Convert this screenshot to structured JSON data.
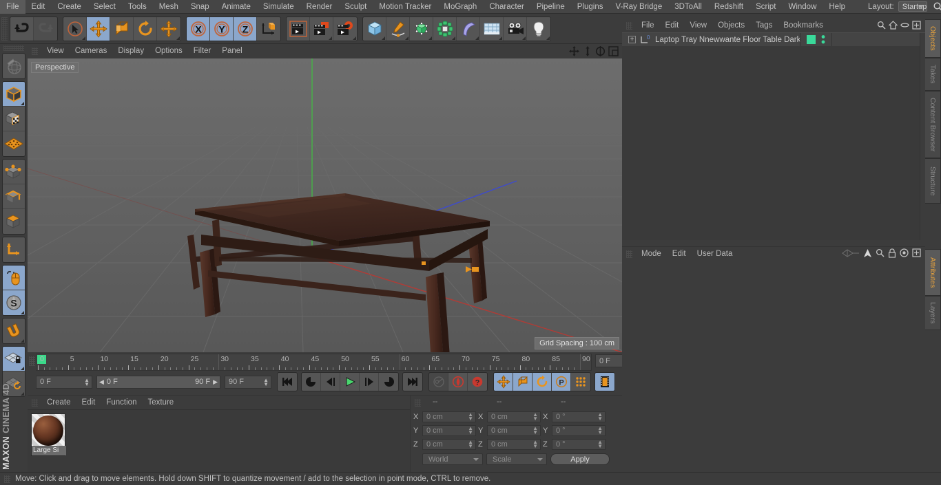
{
  "app": {
    "brand_top": "MAXON",
    "brand_bottom": "CINEMA 4D"
  },
  "menubar": {
    "items": [
      {
        "label": "File"
      },
      {
        "label": "Edit"
      },
      {
        "label": "Create"
      },
      {
        "label": "Select"
      },
      {
        "label": "Tools"
      },
      {
        "label": "Mesh"
      },
      {
        "label": "Snap"
      },
      {
        "label": "Animate"
      },
      {
        "label": "Simulate"
      },
      {
        "label": "Render"
      },
      {
        "label": "Sculpt"
      },
      {
        "label": "Motion Tracker"
      },
      {
        "label": "MoGraph"
      },
      {
        "label": "Character"
      },
      {
        "label": "Pipeline"
      },
      {
        "label": "Plugins"
      },
      {
        "label": "V-Ray Bridge"
      },
      {
        "label": "3DToAll"
      },
      {
        "label": "Redshift"
      },
      {
        "label": "Script"
      },
      {
        "label": "Window"
      },
      {
        "label": "Help"
      }
    ],
    "layout_label": "Layout:",
    "layout_value": "Startup",
    "search_icon": "search-icon"
  },
  "toolbar": {
    "groups": [
      {
        "name": "history",
        "buttons": [
          {
            "name": "undo-button",
            "icon": "undo-arrow-icon",
            "state": "normal"
          },
          {
            "name": "redo-button",
            "icon": "redo-arrow-icon",
            "state": "disabled"
          }
        ]
      },
      {
        "name": "transform-tools",
        "buttons": [
          {
            "name": "live-selection-tool",
            "icon": "cursor-circle-icon",
            "state": "normal"
          },
          {
            "name": "move-tool",
            "icon": "move-arrows-icon",
            "state": "active"
          },
          {
            "name": "scale-tool",
            "icon": "scale-box-icon",
            "state": "normal"
          },
          {
            "name": "rotate-tool",
            "icon": "rotate-circle-icon",
            "state": "normal"
          },
          {
            "name": "dynamic-place-tool",
            "icon": "move-arrows-icon",
            "state": "normal"
          }
        ]
      },
      {
        "name": "axis-locks",
        "buttons": [
          {
            "name": "lock-x-axis",
            "icon": "x-axis-icon",
            "label": "X",
            "state": "active"
          },
          {
            "name": "lock-y-axis",
            "icon": "y-axis-icon",
            "label": "Y",
            "state": "active"
          },
          {
            "name": "lock-z-axis",
            "icon": "z-axis-icon",
            "label": "Z",
            "state": "active"
          },
          {
            "name": "world-object-coord-toggle",
            "icon": "coord-system-icon",
            "state": "normal"
          }
        ]
      },
      {
        "name": "render-tools",
        "buttons": [
          {
            "name": "render-view-button",
            "icon": "render-view-icon",
            "state": "normal"
          },
          {
            "name": "render-region-button",
            "icon": "render-region-icon",
            "state": "normal"
          },
          {
            "name": "render-settings-button",
            "icon": "render-settings-icon",
            "state": "normal"
          }
        ]
      },
      {
        "name": "create-objects",
        "buttons": [
          {
            "name": "add-cube-button",
            "icon": "cube-icon",
            "state": "normal"
          },
          {
            "name": "add-spline-button",
            "icon": "pen-spline-icon",
            "state": "normal"
          },
          {
            "name": "add-nurbs-button",
            "icon": "green-cube-icon",
            "state": "normal"
          },
          {
            "name": "add-array-button",
            "icon": "array-icon",
            "state": "normal"
          },
          {
            "name": "add-deformer-button",
            "icon": "bend-deformer-icon",
            "state": "normal"
          },
          {
            "name": "add-environment-button",
            "icon": "floor-grid-icon",
            "state": "normal"
          },
          {
            "name": "add-camera-button",
            "icon": "camera-icon",
            "state": "normal"
          },
          {
            "name": "add-light-button",
            "icon": "light-bulb-icon",
            "state": "normal"
          }
        ]
      }
    ]
  },
  "leftbar": {
    "groups": [
      {
        "buttons": [
          {
            "name": "make-editable-button",
            "icon": "globe-wire-icon",
            "state": "disabled"
          }
        ]
      },
      {
        "buttons": [
          {
            "name": "model-mode-button",
            "icon": "model-cube-icon",
            "state": "active"
          },
          {
            "name": "texture-mode-button",
            "icon": "texture-cube-icon",
            "state": "normal"
          },
          {
            "name": "workplane-mode-button",
            "icon": "workplane-grid-icon",
            "state": "normal"
          }
        ]
      },
      {
        "buttons": [
          {
            "name": "points-mode-button",
            "icon": "points-cube-icon",
            "state": "normal"
          },
          {
            "name": "edges-mode-button",
            "icon": "edges-cube-icon",
            "state": "normal"
          },
          {
            "name": "polygons-mode-button",
            "icon": "polygons-cube-icon",
            "state": "normal"
          }
        ]
      },
      {
        "buttons": [
          {
            "name": "axis-mode-button",
            "icon": "axis-l-icon",
            "state": "normal"
          }
        ]
      },
      {
        "buttons": [
          {
            "name": "enable-axis-modification-button",
            "icon": "mouse-icon",
            "state": "active"
          },
          {
            "name": "world-coordinates-button",
            "icon": "compass-s-icon",
            "state": "active"
          }
        ]
      },
      {
        "buttons": [
          {
            "name": "snap-magnet-button",
            "icon": "magnet-icon",
            "state": "normal"
          }
        ]
      },
      {
        "buttons": [
          {
            "name": "lock-workplane-button",
            "icon": "workplane-lock-icon",
            "state": "active"
          },
          {
            "name": "planar-workplane-button",
            "icon": "workplane-rotate-icon",
            "state": "normal"
          }
        ]
      }
    ]
  },
  "viewport": {
    "menu": [
      {
        "label": "View"
      },
      {
        "label": "Cameras"
      },
      {
        "label": "Display"
      },
      {
        "label": "Options"
      },
      {
        "label": "Filter"
      },
      {
        "label": "Panel"
      }
    ],
    "view_label": "Perspective",
    "grid_spacing": "Grid Spacing : 100 cm",
    "axes": [
      {
        "label": "Y",
        "color": "#33cc33"
      },
      {
        "label": "Z",
        "color": "#3a4ee0"
      },
      {
        "label": "X",
        "color": "#d33a3a"
      }
    ],
    "view_icons": [
      {
        "name": "pan-view-icon"
      },
      {
        "name": "dolly-view-icon"
      },
      {
        "name": "rotate-view-icon"
      },
      {
        "name": "maximize-view-icon"
      }
    ],
    "colors": {
      "background_top": "#6e6e6e",
      "background_bottom": "#5a5a5a",
      "grid_line": "#6a6a6a",
      "x_axis": "#c0392b",
      "y_axis": "#3ba53b",
      "z_axis": "#3a4ee0",
      "table_wood_top": "#3a241d",
      "table_wood_leg": "#4e3026"
    }
  },
  "timeline": {
    "ticks": [
      "0",
      "5",
      "10",
      "15",
      "20",
      "25",
      "30",
      "35",
      "40",
      "45",
      "50",
      "55",
      "60",
      "65",
      "70",
      "75",
      "80",
      "85",
      "90"
    ],
    "current_frame_field": "0 F",
    "start_frame": "0 F",
    "slider_min": "0 F",
    "slider_max": "90 F",
    "end_frame": "90 F",
    "playhead_frame": 0,
    "range_start": 0,
    "range_end": 90
  },
  "playback": {
    "buttons": [
      {
        "name": "go-to-start-button",
        "icon": "skip-start-icon",
        "state": "normal"
      },
      {
        "name": "go-to-previous-keyframe-button",
        "icon": "prev-key-icon",
        "state": "normal"
      },
      {
        "name": "step-back-button",
        "icon": "step-back-icon",
        "state": "normal"
      },
      {
        "name": "play-button",
        "icon": "play-icon",
        "state": "normal"
      },
      {
        "name": "step-forward-button",
        "icon": "step-forward-icon",
        "state": "normal"
      },
      {
        "name": "go-to-next-keyframe-button",
        "icon": "next-key-icon",
        "state": "normal"
      },
      {
        "name": "go-to-end-button",
        "icon": "skip-end-icon",
        "state": "normal"
      },
      {
        "name": "record-active-objects-button",
        "icon": "key-icon",
        "state": "disabled"
      },
      {
        "name": "autokeying-button",
        "icon": "red-circle-icon",
        "state": "normal"
      },
      {
        "name": "keyframe-selection-button",
        "icon": "red-question-icon",
        "state": "normal"
      },
      {
        "name": "record-position-button",
        "icon": "move-arrows-icon",
        "state": "active"
      },
      {
        "name": "record-scale-button",
        "icon": "scale-box-icon",
        "state": "active"
      },
      {
        "name": "record-rotation-button",
        "icon": "rotate-circle-icon",
        "state": "active"
      },
      {
        "name": "record-pla-button",
        "icon": "p-circle-icon",
        "state": "active"
      },
      {
        "name": "record-parameter-button",
        "icon": "dots-grid-icon",
        "state": "normal"
      },
      {
        "name": "keyframe-mode-button",
        "icon": "film-strip-icon",
        "state": "active"
      }
    ]
  },
  "materials": {
    "menu": [
      {
        "label": "Create"
      },
      {
        "label": "Edit"
      },
      {
        "label": "Function"
      },
      {
        "label": "Texture"
      }
    ],
    "items": [
      {
        "name": "Large Si",
        "color": "#6b3a25"
      }
    ]
  },
  "coordinates": {
    "col_headers": [
      "--",
      "--",
      "--"
    ],
    "rows": [
      {
        "label": "X",
        "position": "0 cm",
        "size": "0 cm",
        "rot_label": "X",
        "rotation": "0 °"
      },
      {
        "label": "Y",
        "position": "0 cm",
        "size": "0 cm",
        "rot_label": "Y",
        "rotation": "0 °"
      },
      {
        "label": "Z",
        "position": "0 cm",
        "size": "0 cm",
        "rot_label": "Z",
        "rotation": "0 °"
      }
    ],
    "coord_system": "World",
    "transform_mode": "Scale",
    "apply_label": "Apply"
  },
  "object_manager": {
    "menu": [
      {
        "label": "File"
      },
      {
        "label": "Edit"
      },
      {
        "label": "View"
      },
      {
        "label": "Objects"
      },
      {
        "label": "Tags"
      },
      {
        "label": "Bookmarks"
      }
    ],
    "header_icons": [
      {
        "name": "search-icon"
      },
      {
        "name": "home-icon"
      },
      {
        "name": "ellipse-icon"
      },
      {
        "name": "new-window-icon"
      }
    ],
    "objects": [
      {
        "name": "Laptop Tray Nnewwante Floor Table Dark",
        "expand_icon": "expand-plus-icon",
        "type_icon": "null-object-icon",
        "tag_color": "#3ad99a",
        "visible_dot_top": "#3ad99a",
        "visible_dot_bottom": "#3ad99a"
      }
    ]
  },
  "attributes": {
    "menu": [
      {
        "label": "Mode"
      },
      {
        "label": "Edit"
      },
      {
        "label": "User Data"
      }
    ],
    "header_icons": [
      {
        "name": "history-wave-icon"
      },
      {
        "name": "pin-arrow-icon"
      },
      {
        "name": "search-icon"
      },
      {
        "name": "lock-icon"
      },
      {
        "name": "target-icon"
      },
      {
        "name": "new-window-icon"
      }
    ]
  },
  "vertical_tabs": {
    "top_group": [
      {
        "label": "Objects",
        "selected": true
      },
      {
        "label": "Takes",
        "selected": false
      },
      {
        "label": "Content Browser",
        "selected": false
      },
      {
        "label": "Structure",
        "selected": false
      }
    ],
    "bottom_group": [
      {
        "label": "Attributes",
        "selected": true
      },
      {
        "label": "Layers",
        "selected": false
      }
    ]
  },
  "statusbar": {
    "message": "Move: Click and drag to move elements. Hold down SHIFT to quantize movement / add to the selection in point mode, CTRL to remove."
  }
}
